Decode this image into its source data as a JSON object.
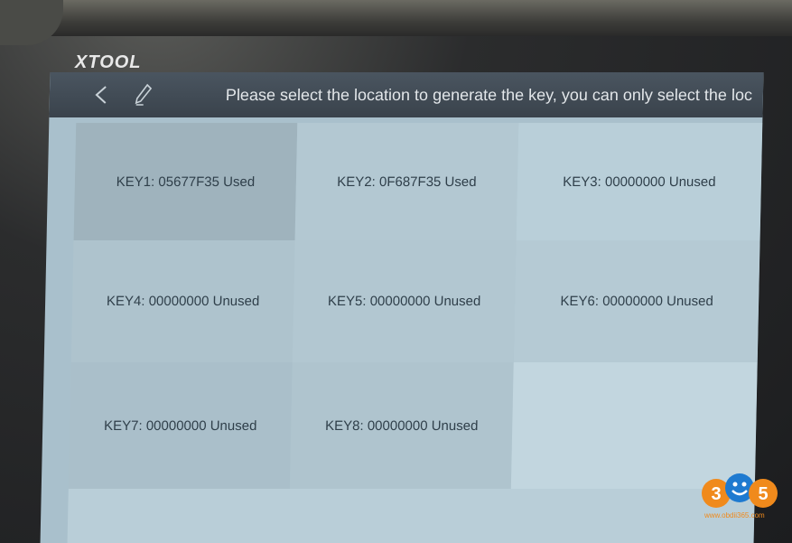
{
  "device": {
    "brand": "XTOOL"
  },
  "header": {
    "title": "Please select the location to generate the key, you can only select the loc"
  },
  "keys": [
    {
      "label": "KEY1: 05677F35 Used"
    },
    {
      "label": "KEY2: 0F687F35 Used"
    },
    {
      "label": "KEY3: 00000000 Unused"
    },
    {
      "label": "KEY4: 00000000 Unused"
    },
    {
      "label": "KEY5: 00000000 Unused"
    },
    {
      "label": "KEY6: 00000000 Unused"
    },
    {
      "label": "KEY7: 00000000 Unused"
    },
    {
      "label": "KEY8: 00000000 Unused"
    }
  ],
  "watermark": {
    "logo_text": "365",
    "url": "www.obdii365.com"
  },
  "colors": {
    "screen_bg": "#a9c0cc",
    "titlebar_bg": "#3f4952",
    "key_text": "#2f3f4a",
    "watermark": "#f08a1c"
  },
  "icons": [
    "back-arrow-icon",
    "edit-pencil-icon"
  ]
}
